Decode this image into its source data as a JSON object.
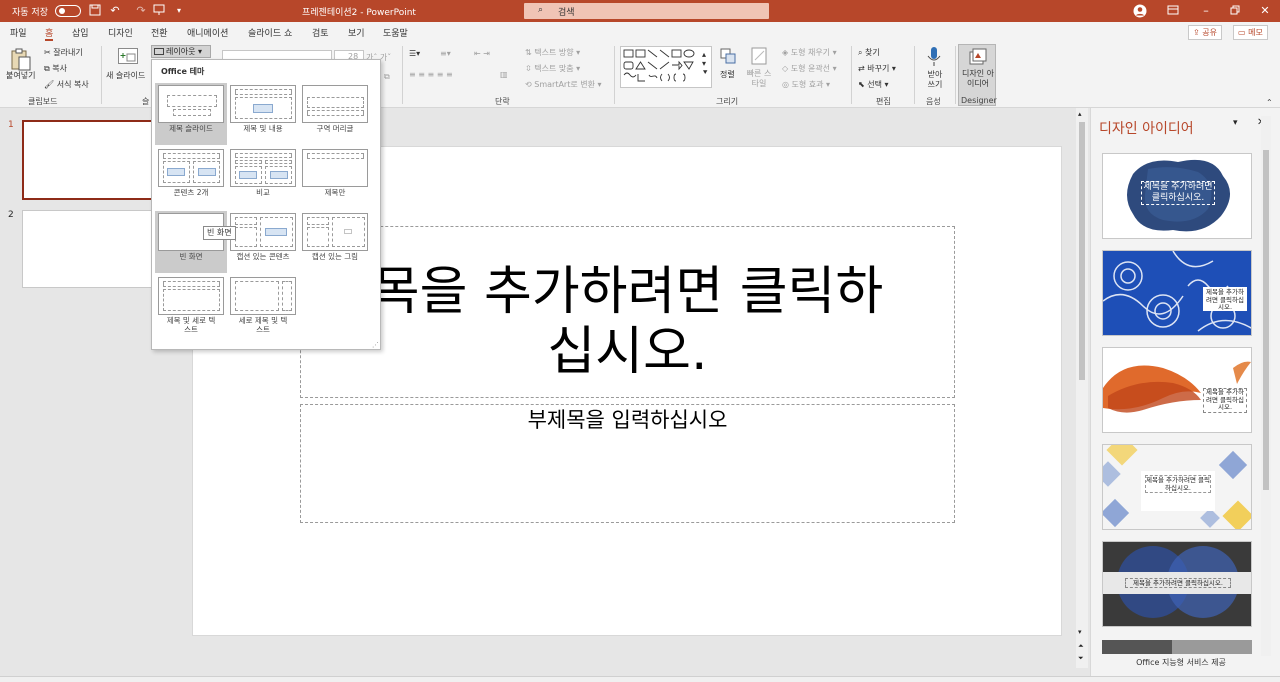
{
  "titlebar": {
    "autosave_label": "자동 저장",
    "autosave_state": "끔",
    "doc_title": "프레젠테이션2 - PowerPoint",
    "search_placeholder": "검색"
  },
  "menu": {
    "tabs": [
      "파일",
      "홈",
      "삽입",
      "디자인",
      "전환",
      "애니메이션",
      "슬라이드 쇼",
      "검토",
      "보기",
      "도움말"
    ],
    "active": "홈",
    "share_label": "공유",
    "comment_label": "메모"
  },
  "ribbon": {
    "clipboard": {
      "paste": "붙여넣기",
      "cut": "잘라내기",
      "copy": "복사",
      "format_painter": "서식 복사",
      "group": "클립보드"
    },
    "slides": {
      "new_slide": "새 슬라이드",
      "layout": "레이아웃",
      "group": "슬"
    },
    "paragraph": {
      "text_direction": "텍스트 방향",
      "align_text": "텍스트 맞춤",
      "smartart": "SmartArt로 변환",
      "group": "단락"
    },
    "drawing": {
      "arrange": "정렬",
      "quick_styles": "빠른 스타일",
      "shape_fill": "도형 채우기",
      "shape_outline": "도형 윤곽선",
      "shape_effects": "도형 효과",
      "group": "그리기"
    },
    "editing": {
      "find": "찾기",
      "replace": "바꾸기",
      "select": "선택",
      "group": "편집"
    },
    "voice": {
      "dictate": "받아 쓰기",
      "group": "음성"
    },
    "designer": {
      "design_ideas": "디자인 아이디어",
      "group": "Designer"
    }
  },
  "layout_dropdown": {
    "header": "Office 테마",
    "items": [
      {
        "label": "제목 슬라이드",
        "selected": true
      },
      {
        "label": "제목 및 내용"
      },
      {
        "label": "구역 머리글"
      },
      {
        "label": "콘텐츠 2개"
      },
      {
        "label": "비교"
      },
      {
        "label": "제목만"
      },
      {
        "label": "빈 화면",
        "hover": true
      },
      {
        "label": "캡션 있는 콘텐츠"
      },
      {
        "label": "캡션 있는 그림"
      },
      {
        "label": "제목 및 세로 텍스트"
      },
      {
        "label": "세로 제목 및 텍스트"
      }
    ],
    "tooltip": "빈 화면"
  },
  "slides_panel": {
    "numbers": [
      "1",
      "2"
    ]
  },
  "slide": {
    "title_line1": "목을 추가하려면 클릭하",
    "title_line2": "십시오.",
    "subtitle": "부제목을 입력하십시오"
  },
  "design_pane": {
    "title": "디자인 아이디어",
    "cards": [
      {
        "caption": "제목을 추가하려면 클릭하십시오."
      },
      {
        "caption": "제목을 추가하려면 클릭하십시오."
      },
      {
        "caption": "제목을 추가하려면 클릭하십시오."
      },
      {
        "caption": "제목을 추가하려면 클릭하십시오."
      },
      {
        "caption": "제목을 추가하려면 클릭하십시오."
      }
    ],
    "footer": "Office 지능형 서비스 제공"
  },
  "colors": {
    "accent": "#b7472a",
    "selection": "#8e2b18"
  }
}
